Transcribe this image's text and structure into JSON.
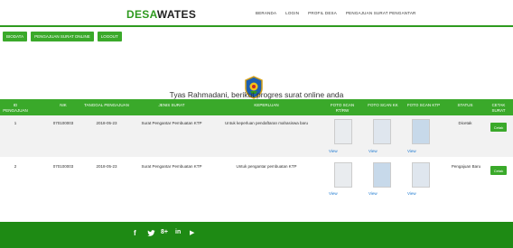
{
  "header": {
    "brand_part1": "DESA",
    "brand_part2": "WATES",
    "nav": [
      "BERANDA",
      "LOGIN",
      "PROFIL DESA",
      "PENGAJUAN SURAT PENGANTAR"
    ]
  },
  "actions": [
    "BIODATA",
    "PENGAJUAN SURAT ONLINE",
    "LOGOUT"
  ],
  "greeting": "Tyas Rahmadani, berikut progres surat online anda",
  "table": {
    "columns": [
      "ID PENGAJUAN",
      "NIK",
      "TANGGAL PENGAJUAN",
      "JENIS SURAT",
      "KEPERLUAN",
      "FOTO SCAN RT/RW",
      "FOTO SCAN KK",
      "FOTO SCAN KTP",
      "STATUS",
      "CETAK SURAT"
    ],
    "rows": [
      {
        "id": "1",
        "nik": "070100003",
        "tanggal": "2018-05-23",
        "jenis": "Surat Pengantar Pembuatan KTP",
        "keperluan": "Untuk keperluan pendaftaran mahasiswa baru",
        "view_rtrw": "View",
        "view_kk": "View",
        "view_ktp": "View",
        "status": "Dicetak",
        "cetak": "Cetak"
      },
      {
        "id": "2",
        "nik": "070100003",
        "tanggal": "2018-05-23",
        "jenis": "Surat Pengantar Pembuatan KTP",
        "keperluan": "Untuk pengantar pembuatan KTP",
        "view_rtrw": "View",
        "view_kk": "View",
        "view_ktp": "View",
        "status": "Pengajuan Baru",
        "cetak": "Cetak"
      }
    ]
  },
  "footer": {
    "social": [
      "f",
      " ",
      "8+",
      "in",
      "▶"
    ]
  },
  "colors": {
    "accent": "#3aa92a",
    "footer": "#1e8a14",
    "link": "#1f7ad1"
  }
}
